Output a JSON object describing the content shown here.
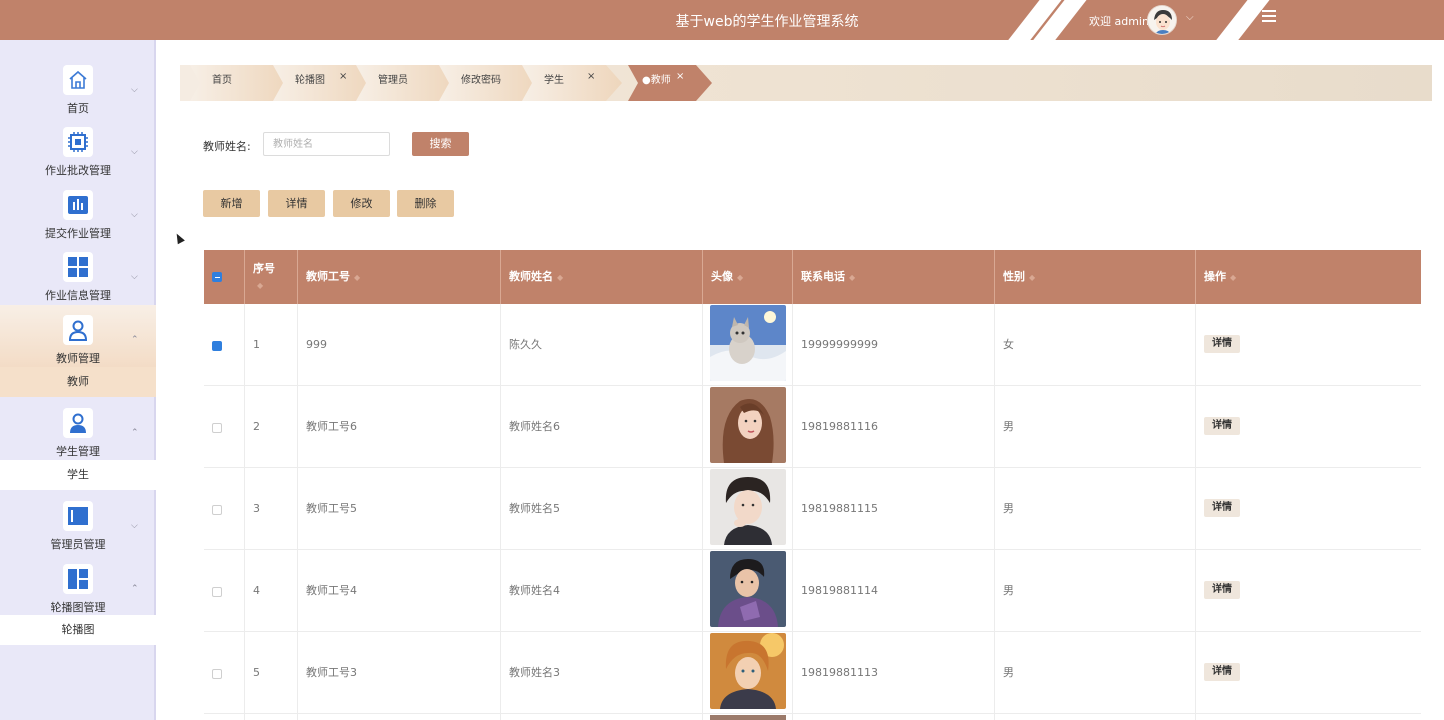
{
  "header": {
    "title": "基于web的学生作业管理系统",
    "welcome": "欢迎 admin",
    "accent_color": "#c0826a"
  },
  "sidebar": {
    "items": [
      {
        "label": "首页",
        "icon": "home-icon"
      },
      {
        "label": "作业批改管理",
        "icon": "chip-icon"
      },
      {
        "label": "提交作业管理",
        "icon": "bar-chart-icon"
      },
      {
        "label": "作业信息管理",
        "icon": "grid-icon"
      },
      {
        "label": "教师管理",
        "icon": "user-icon",
        "sub": "教师"
      },
      {
        "label": "学生管理",
        "icon": "user-icon",
        "sub": "学生"
      },
      {
        "label": "管理员管理",
        "icon": "panel-icon"
      },
      {
        "label": "轮播图管理",
        "icon": "layout-icon",
        "sub": "轮播图"
      }
    ]
  },
  "tabs": [
    {
      "label": "首页"
    },
    {
      "label": "轮播图"
    },
    {
      "label": "管理员"
    },
    {
      "label": "修改密码"
    },
    {
      "label": "学生"
    },
    {
      "label": "●教师"
    }
  ],
  "search": {
    "label": "教师姓名:",
    "placeholder": "教师姓名",
    "button": "搜索"
  },
  "actions": {
    "add": "新增",
    "detail": "详情",
    "edit": "修改",
    "delete": "删除"
  },
  "table": {
    "columns": [
      "序号",
      "教师工号",
      "教师姓名",
      "头像",
      "联系电话",
      "性别",
      "操作"
    ],
    "rows": [
      {
        "index": "1",
        "id": "999",
        "name": "陈久久",
        "phone": "19999999999",
        "gender": "女",
        "checked": true,
        "action": "详情"
      },
      {
        "index": "2",
        "id": "教师工号6",
        "name": "教师姓名6",
        "phone": "19819881116",
        "gender": "男",
        "checked": false,
        "action": "详情"
      },
      {
        "index": "3",
        "id": "教师工号5",
        "name": "教师姓名5",
        "phone": "19819881115",
        "gender": "男",
        "checked": false,
        "action": "详情"
      },
      {
        "index": "4",
        "id": "教师工号4",
        "name": "教师姓名4",
        "phone": "19819881114",
        "gender": "男",
        "checked": false,
        "action": "详情"
      },
      {
        "index": "5",
        "id": "教师工号3",
        "name": "教师姓名3",
        "phone": "19819881113",
        "gender": "男",
        "checked": false,
        "action": "详情"
      }
    ]
  }
}
